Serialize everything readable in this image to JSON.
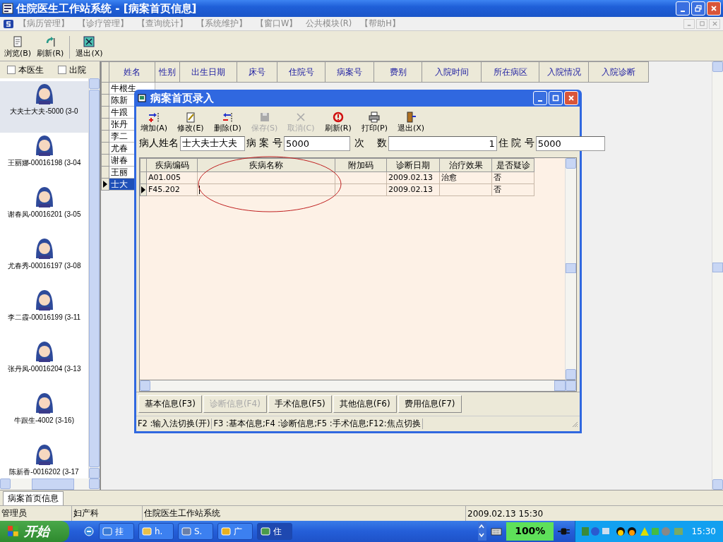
{
  "window": {
    "title": "住院医生工作站系统 - [病案首页信息]"
  },
  "menu": [
    "【病历管理】",
    "【诊疗管理】",
    "【查询统计】",
    "【系统维护】",
    "【窗口W】",
    "公共模块(R)",
    "【帮助H】"
  ],
  "toolbar": [
    {
      "label": "浏览(B)",
      "kind": "browse"
    },
    {
      "label": "刷新(R)",
      "kind": "refresh"
    },
    {
      "label": "退出(X)",
      "kind": "exit"
    }
  ],
  "filters": [
    {
      "label": "本医生",
      "checked": false
    },
    {
      "label": "出院",
      "checked": false
    }
  ],
  "patients": [
    {
      "label": "大夫士大夫-5000 (3-0",
      "selected": true
    },
    {
      "label": "王丽娜-00016198 (3-04",
      "selected": false
    },
    {
      "label": "谢春凤-00016201 (3-05",
      "selected": false
    },
    {
      "label": "尤春秀-00016197 (3-08",
      "selected": false
    },
    {
      "label": "李二霞-00016199 (3-11",
      "selected": false
    },
    {
      "label": "张丹凤-00016204 (3-13",
      "selected": false
    },
    {
      "label": "牛跟生-4002 (3-16)",
      "selected": false
    },
    {
      "label": "陈新香-0016202 (3-17",
      "selected": false
    }
  ],
  "grid": {
    "columns": [
      "姓名",
      "性别",
      "出生日期",
      "床号",
      "住院号",
      "病案号",
      "费别",
      "入院时间",
      "所在病区",
      "入院情况",
      "入院诊断"
    ],
    "rows": [
      {
        "name": "牛根生",
        "selected": false
      },
      {
        "name": "陈新",
        "selected": false
      },
      {
        "name": "牛跟",
        "selected": false
      },
      {
        "name": "张丹",
        "selected": false
      },
      {
        "name": "李二",
        "selected": false
      },
      {
        "name": "尤春",
        "selected": false
      },
      {
        "name": "谢春",
        "selected": false
      },
      {
        "name": "王丽",
        "selected": false
      },
      {
        "name": "士大",
        "selected": true
      }
    ]
  },
  "dialog": {
    "title": "病案首页录入",
    "toolbar": [
      {
        "label": "增加(A)",
        "kind": "add",
        "disabled": false
      },
      {
        "label": "修改(E)",
        "kind": "edit",
        "disabled": false
      },
      {
        "label": "删除(D)",
        "kind": "delete",
        "disabled": false
      },
      {
        "label": "保存(S)",
        "kind": "save",
        "disabled": true
      },
      {
        "label": "取消(C)",
        "kind": "cancel",
        "disabled": true
      },
      {
        "label": "刷新(R)",
        "kind": "refresh",
        "disabled": false
      },
      {
        "label": "打印(P)",
        "kind": "print",
        "disabled": false
      },
      {
        "label": "退出(X)",
        "kind": "exit",
        "disabled": false
      }
    ],
    "fields": [
      {
        "label": "病人姓名",
        "value": "士大夫士大夫"
      },
      {
        "label": "病 案 号",
        "value": "5000"
      },
      {
        "label": "次    数",
        "value": "1"
      },
      {
        "label": "住 院 号",
        "value": "5000"
      }
    ],
    "columns": [
      "疾病编码",
      "疾病名称",
      "附加码",
      "诊断日期",
      "治疗效果",
      "是否疑诊"
    ],
    "rows": [
      {
        "cells": [
          "A01.005",
          "",
          "",
          "2009.02.13",
          "治愈",
          "否"
        ],
        "selected": false
      },
      {
        "cells": [
          "F45.202",
          "",
          "",
          "2009.02.13",
          "",
          "否"
        ],
        "selected": true
      }
    ],
    "tabs": [
      {
        "label": "基本信息(F3)",
        "disabled": false
      },
      {
        "label": "诊断信息(F4)",
        "disabled": true
      },
      {
        "label": "手术信息(F5)",
        "disabled": false
      },
      {
        "label": "其他信息(F6)",
        "disabled": false
      },
      {
        "label": "费用信息(F7)",
        "disabled": false
      }
    ],
    "status": [
      "F2 :输入法切换(开)",
      "F3 :基本信息;F4 :诊断信息;F5 :手术信息;F12:焦点切换"
    ]
  },
  "tabs": [
    {
      "label": "病案首页信息",
      "selected": true
    }
  ],
  "status_bar": [
    "管理员",
    "妇产科",
    "住院医生工作站系统",
    "2009.02.13 15:30"
  ],
  "taskbar": {
    "start": "开始",
    "tasks": [
      {
        "label": "挂",
        "selected": false
      },
      {
        "label": "h.",
        "selected": false
      },
      {
        "label": "S.",
        "selected": false
      },
      {
        "label": "广",
        "selected": false
      },
      {
        "label": "住",
        "selected": true
      }
    ],
    "battery": "100%",
    "clock": "15:30"
  }
}
